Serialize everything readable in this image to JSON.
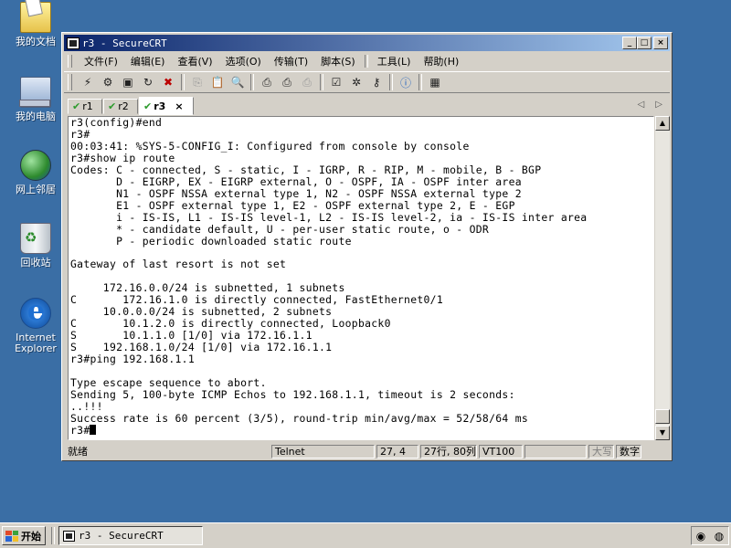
{
  "desktop": {
    "icons": [
      {
        "label": "我的文档",
        "icon": "my-documents-icon"
      },
      {
        "label": "我的电脑",
        "icon": "my-computer-icon"
      },
      {
        "label": "网上邻居",
        "icon": "network-places-icon"
      },
      {
        "label": "回收站",
        "icon": "recycle-bin-icon"
      },
      {
        "label": "Internet Explorer",
        "icon": "internet-explorer-icon"
      }
    ]
  },
  "window": {
    "title": "r3 - SecureCRT",
    "controls": {
      "minimize": "_",
      "maximize": "□",
      "close": "×"
    }
  },
  "menu": [
    "文件(F)",
    "编辑(E)",
    "查看(V)",
    "选项(O)",
    "传输(T)",
    "脚本(S)",
    "工具(L)",
    "帮助(H)"
  ],
  "tabs": [
    {
      "label": "r1",
      "active": false
    },
    {
      "label": "r2",
      "active": false
    },
    {
      "label": "r3",
      "active": true,
      "close": "×"
    }
  ],
  "tab_nav": {
    "left": "◁",
    "right": "▷"
  },
  "terminal": {
    "lines": [
      "r3(config)#end",
      "r3#",
      "00:03:41: %SYS-5-CONFIG_I: Configured from console by console",
      "r3#show ip route",
      "Codes: C - connected, S - static, I - IGRP, R - RIP, M - mobile, B - BGP",
      "       D - EIGRP, EX - EIGRP external, O - OSPF, IA - OSPF inter area",
      "       N1 - OSPF NSSA external type 1, N2 - OSPF NSSA external type 2",
      "       E1 - OSPF external type 1, E2 - OSPF external type 2, E - EGP",
      "       i - IS-IS, L1 - IS-IS level-1, L2 - IS-IS level-2, ia - IS-IS inter area",
      "       * - candidate default, U - per-user static route, o - ODR",
      "       P - periodic downloaded static route",
      "",
      "Gateway of last resort is not set",
      "",
      "     172.16.0.0/24 is subnetted, 1 subnets",
      "C       172.16.1.0 is directly connected, FastEthernet0/1",
      "     10.0.0.0/24 is subnetted, 2 subnets",
      "C       10.1.2.0 is directly connected, Loopback0",
      "S       10.1.1.0 [1/0] via 172.16.1.1",
      "S    192.168.1.0/24 [1/0] via 172.16.1.1",
      "r3#ping 192.168.1.1",
      "",
      "Type escape sequence to abort.",
      "Sending 5, 100-byte ICMP Echos to 192.168.1.1, timeout is 2 seconds:",
      "..!!!",
      "Success rate is 60 percent (3/5), round-trip min/avg/max = 52/58/64 ms"
    ],
    "prompt": "r3#"
  },
  "scrollbar": {
    "up": "▲",
    "down": "▼"
  },
  "status": {
    "ready": "就绪",
    "protocol": "Telnet",
    "cursor": "27,  4",
    "size": "27行, 80列",
    "emulation": "VT100",
    "caps": "大写",
    "num": "数字"
  },
  "taskbar": {
    "start": "开始",
    "task": "r3 - SecureCRT"
  }
}
